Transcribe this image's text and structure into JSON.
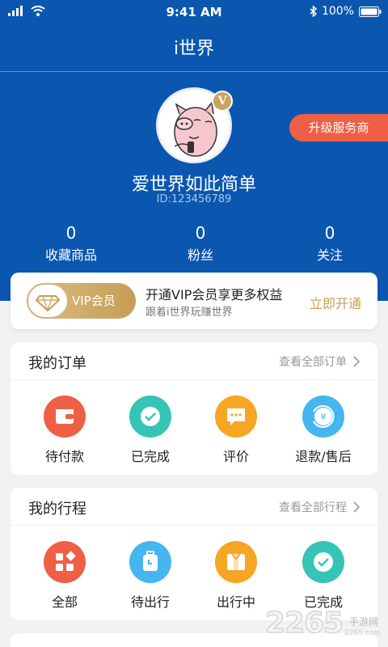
{
  "status_bar": {
    "time": "9:41 AM",
    "battery": "100%"
  },
  "nav": {
    "title": "i世界"
  },
  "profile": {
    "vip_letter": "V",
    "upgrade_label": "升级服务商",
    "name": "爱世界如此简单",
    "id": "ID:123456789"
  },
  "stats": [
    {
      "value": "0",
      "label": "收藏商品"
    },
    {
      "value": "0",
      "label": "粉丝"
    },
    {
      "value": "0",
      "label": "关注"
    }
  ],
  "vip_banner": {
    "badge": "VIP会员",
    "title": "开通VIP会员享更多权益",
    "subtitle": "跟着i世界玩赚世界",
    "action": "立即开通"
  },
  "orders": {
    "title": "我的订单",
    "more": "查看全部订单",
    "items": [
      {
        "label": "待付款",
        "icon": "wallet-icon",
        "color": "#ef5f45"
      },
      {
        "label": "已完成",
        "icon": "check-icon",
        "color": "#36c4b6"
      },
      {
        "label": "评价",
        "icon": "chat-icon",
        "color": "#f6a623"
      },
      {
        "label": "退款/售后",
        "icon": "refund-icon",
        "color": "#45b6f0"
      }
    ]
  },
  "trips": {
    "title": "我的行程",
    "more": "查看全部行程",
    "items": [
      {
        "label": "全部",
        "icon": "grid-icon",
        "color": "#ef5f45"
      },
      {
        "label": "待出行",
        "icon": "luggage-icon",
        "color": "#45b6f0"
      },
      {
        "label": "出行中",
        "icon": "gift-icon",
        "color": "#f6a623"
      },
      {
        "label": "已完成",
        "icon": "check-icon",
        "color": "#36c4b6"
      }
    ]
  },
  "watermark": {
    "number": "2265",
    "text": "手游网",
    "url": "2265.com"
  },
  "colors": {
    "brand_blue": "#0b57b0",
    "accent_red": "#ef5f45",
    "gold": "#c69d55"
  }
}
